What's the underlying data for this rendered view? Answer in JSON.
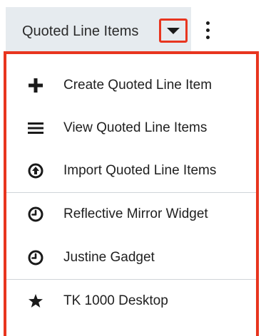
{
  "header": {
    "module_label": "Quoted Line Items",
    "caret_icon": "caret-down-icon",
    "more_icon": "kebab-menu-icon"
  },
  "colors": {
    "highlight": "#e8351f",
    "tab_background": "#e6ebef",
    "divider": "#cfd4d8",
    "text": "#1f1f1f"
  },
  "menu": {
    "items": [
      {
        "label": "Create Quoted Line Item",
        "icon": "plus-icon"
      },
      {
        "label": "View Quoted Line Items",
        "icon": "list-icon"
      },
      {
        "label": "Import Quoted Line Items",
        "icon": "upload-circle-icon"
      },
      {
        "label": "Reflective Mirror Widget",
        "icon": "clock-icon"
      },
      {
        "label": "Justine Gadget",
        "icon": "clock-icon"
      },
      {
        "label": "TK 1000 Desktop",
        "icon": "star-icon"
      }
    ]
  }
}
